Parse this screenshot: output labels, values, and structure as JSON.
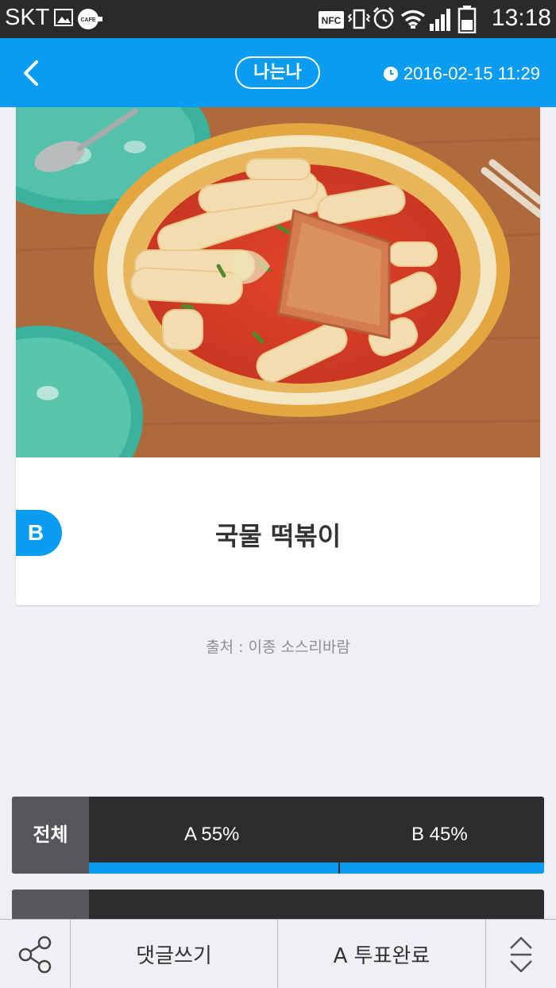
{
  "status_bar": {
    "carrier": "SKT",
    "cafe_badge": "CAFE",
    "nfc_label": "NFC",
    "time": "13:18"
  },
  "header": {
    "nickname": "나는나",
    "timestamp": "2016-02-15 11:29",
    "accent_color": "#0a9cf0"
  },
  "option": {
    "badge": "B",
    "title": "국물 떡볶이",
    "source": "출처 : 이종 소스리바람"
  },
  "results": {
    "total_label": "전체",
    "a_label": "A 55%",
    "b_label": "B 45%",
    "a_percent": 55,
    "b_percent": 45
  },
  "bottom_bar": {
    "comment_label": "댓글쓰기",
    "vote_label": "A 투표완료"
  },
  "icons": [
    "back-chevron-icon",
    "clock-icon",
    "share-icon",
    "scroll-up-down-icon"
  ]
}
